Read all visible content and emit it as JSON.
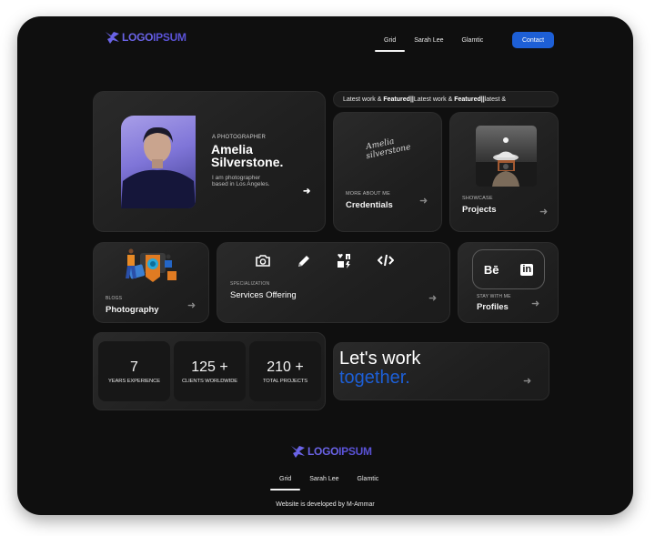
{
  "brand": {
    "logo_icon": "logo-mark-icon",
    "logo_text_a": "LOGO",
    "logo_text_b": "IPSUM",
    "accent": "#5a52d6"
  },
  "header": {
    "nav": [
      {
        "label": "Grid",
        "active": true
      },
      {
        "label": "Sarah Lee",
        "active": false
      },
      {
        "label": "Glamtic",
        "active": false
      }
    ],
    "contact_label": "Contact",
    "contact_color": "#1d5fd6"
  },
  "marquee": {
    "segments": [
      {
        "text": "Latest work & ",
        "bold": false
      },
      {
        "text": "Featured",
        "bold": true
      },
      {
        "text": " || ",
        "bold": true
      },
      {
        "text": "Latest work & ",
        "bold": false
      },
      {
        "text": "Featured",
        "bold": true
      },
      {
        "text": " || ",
        "bold": true
      },
      {
        "text": "latest &",
        "bold": false
      }
    ]
  },
  "intro": {
    "eyebrow": "A PHOTOGRAPHER",
    "name_line1": "Amelia",
    "name_line2": "Silverstone.",
    "bio_line1": "I am photographer",
    "bio_line2": "based in Los Angeles.",
    "arrow": "arrow-right-icon"
  },
  "credentials": {
    "signature_line1": "Amelia",
    "signature_line2": "silverstone",
    "eyebrow": "MORE ABOUT ME",
    "title": "Credentials"
  },
  "projects": {
    "eyebrow": "SHOWCASE",
    "title": "Projects"
  },
  "blogs": {
    "eyebrow": "BLOGS",
    "title": "Photography"
  },
  "services": {
    "eyebrow": "SPECIALIZATION",
    "title": "Services Offering",
    "icons": [
      "camera-icon",
      "pencil-icon",
      "media-icon",
      "code-icon"
    ]
  },
  "profiles": {
    "eyebrow": "STAY WITH ME",
    "title": "Profiles",
    "behance": "Bē",
    "linkedin": "in"
  },
  "stats": [
    {
      "value": "7",
      "label": "YEARS EXPERIENCE"
    },
    {
      "value": "125 +",
      "label": "CLIENTS WORLDWIDE"
    },
    {
      "value": "210 +",
      "label": "TOTAL PROJECTS"
    }
  ],
  "cta": {
    "line1": "Let's work",
    "line2": "together.",
    "line2_color": "#1d5fd6"
  },
  "footer": {
    "nav": [
      {
        "label": "Grid",
        "active": true
      },
      {
        "label": "Sarah Lee",
        "active": false
      },
      {
        "label": "Glamtic",
        "active": false
      }
    ],
    "credit": "Website is developed by M-Ammar"
  }
}
